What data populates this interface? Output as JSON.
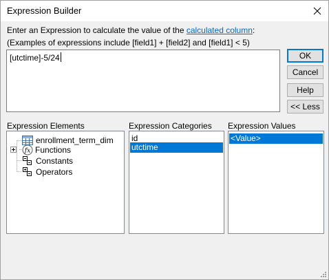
{
  "window": {
    "title": "Expression Builder"
  },
  "intro": {
    "line1_prefix": "Enter an Expression to calculate the value of the ",
    "line1_link": "calculated column",
    "line1_suffix": ":",
    "line2": "(Examples of expressions include [field1] + [field2] and [field1] < 5)"
  },
  "expression": {
    "value": "[utctime]-5/24"
  },
  "buttons": {
    "ok": "OK",
    "cancel": "Cancel",
    "help": "Help",
    "less": "<< Less"
  },
  "sections": {
    "elements_label": "Expression Elements",
    "categories_label": "Expression Categories",
    "values_label": "Expression Values"
  },
  "elements": {
    "items": [
      {
        "label": "enrollment_term_dim",
        "icon": "table-icon"
      },
      {
        "label": "Functions",
        "icon": "function-icon"
      },
      {
        "label": "Constants",
        "icon": "constants-icon"
      },
      {
        "label": "Operators",
        "icon": "operators-icon"
      }
    ]
  },
  "categories": {
    "items": [
      "id",
      "utctime"
    ],
    "selected": "utctime"
  },
  "values": {
    "items": [
      "<Value>"
    ],
    "selected": "<Value>"
  },
  "colors": {
    "selection": "#0078d7",
    "link": "#0066cc",
    "default_button_border": "#0078d7"
  }
}
